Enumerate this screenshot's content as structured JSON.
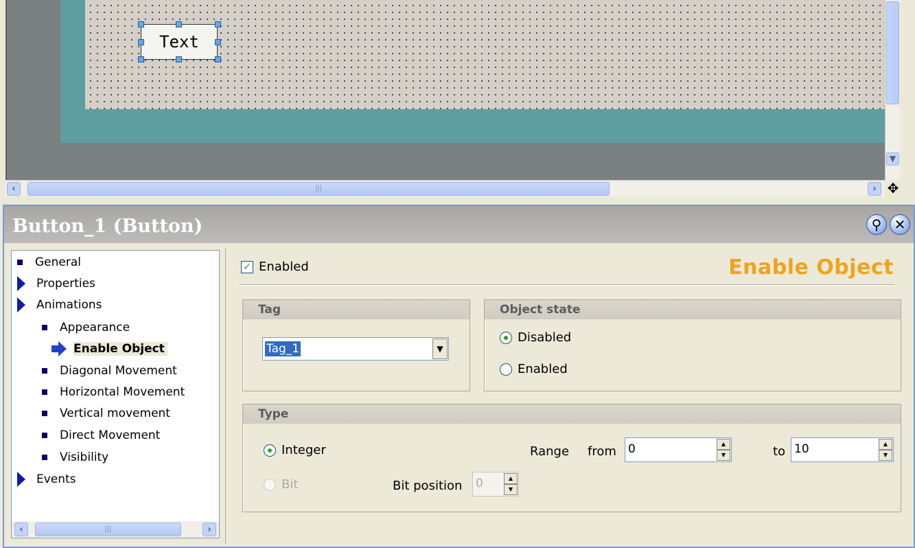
{
  "canvas": {
    "text_object_label": "Text"
  },
  "inspector": {
    "title": "Button_1 (Button)",
    "nav": {
      "items": [
        {
          "label": "General"
        },
        {
          "label": "Properties"
        },
        {
          "label": "Animations"
        },
        {
          "label": "Appearance"
        },
        {
          "label": "Enable Object"
        },
        {
          "label": "Diagonal Movement"
        },
        {
          "label": "Horizontal Movement"
        },
        {
          "label": "Vertical movement"
        },
        {
          "label": "Direct Movement"
        },
        {
          "label": "Visibility"
        },
        {
          "label": "Events"
        }
      ]
    },
    "content": {
      "enabled_label": "Enabled",
      "section_title": "Enable Object",
      "tag_group": {
        "title": "Tag",
        "selected_tag": "Tag_1"
      },
      "state_group": {
        "title": "Object state",
        "options": [
          "Disabled",
          "Enabled"
        ],
        "selected": "Disabled"
      },
      "type_group": {
        "title": "Type",
        "option_integer": "Integer",
        "option_bit": "Bit",
        "range_label": "Range",
        "from_label": "from",
        "from_value": "0",
        "to_label": "to",
        "to_value": "10",
        "bit_position_label": "Bit position",
        "bit_position_value": "0"
      }
    }
  },
  "colors": {
    "section_title": "#f0a31c",
    "screen_teal": "#5f9ea0",
    "selection_blue": "#316ac5"
  }
}
